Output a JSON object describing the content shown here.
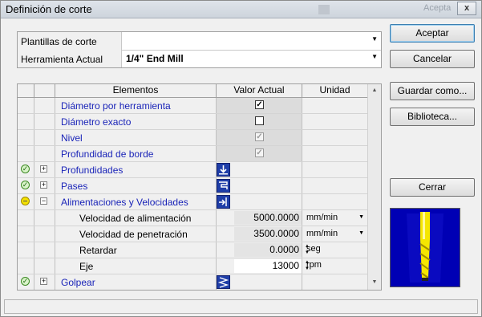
{
  "window": {
    "title": "Definición de corte",
    "ghost_title": "Acepta",
    "close_symbol": "x"
  },
  "combos": [
    {
      "label": "Plantillas de corte",
      "value": ""
    },
    {
      "label": "Herramienta Actual",
      "value": "1/4\" End Mill"
    }
  ],
  "buttons": {
    "accept": "Aceptar",
    "cancel": "Cancelar",
    "save_as": "Guardar como...",
    "library": "Biblioteca...",
    "close": "Cerrar"
  },
  "grid": {
    "headers": {
      "elements": "Elementos",
      "value": "Valor Actual",
      "unit": "Unidad"
    },
    "rows": [
      {
        "name": "Diámetro por herramienta",
        "checked": true
      },
      {
        "name": "Diámetro exacto",
        "checked": false
      },
      {
        "name": "Nivel",
        "checked": true
      },
      {
        "name": "Profundidad de borde",
        "checked": true
      },
      {
        "name": "Profundidades",
        "expander": "+"
      },
      {
        "name": "Pases",
        "expander": "+"
      },
      {
        "name": "Alimentaciones y Velocidades",
        "expander": "−"
      },
      {
        "name": "Velocidad de alimentación",
        "value": "5000.0000",
        "unit": "mm/min"
      },
      {
        "name": "Velocidad de penetración",
        "value": "3500.0000",
        "unit": "mm/min"
      },
      {
        "name": "Retardar",
        "value": "0.0000",
        "unit": "seg"
      },
      {
        "name": "Eje",
        "value": "13000",
        "unit": "rpm"
      },
      {
        "name": "Golpear",
        "expander": "+"
      }
    ]
  },
  "icons": {
    "status_ok": "check-circle-icon",
    "status_warn": "warning-circle-icon",
    "depth": "depth-icon",
    "passes": "passes-icon",
    "feeds": "feeds-speeds-icon",
    "tap": "tap-icon"
  },
  "colors": {
    "link_blue": "#1a24b8",
    "preview_bg": "#0000b4",
    "tool_yellow": "#f5e600"
  }
}
